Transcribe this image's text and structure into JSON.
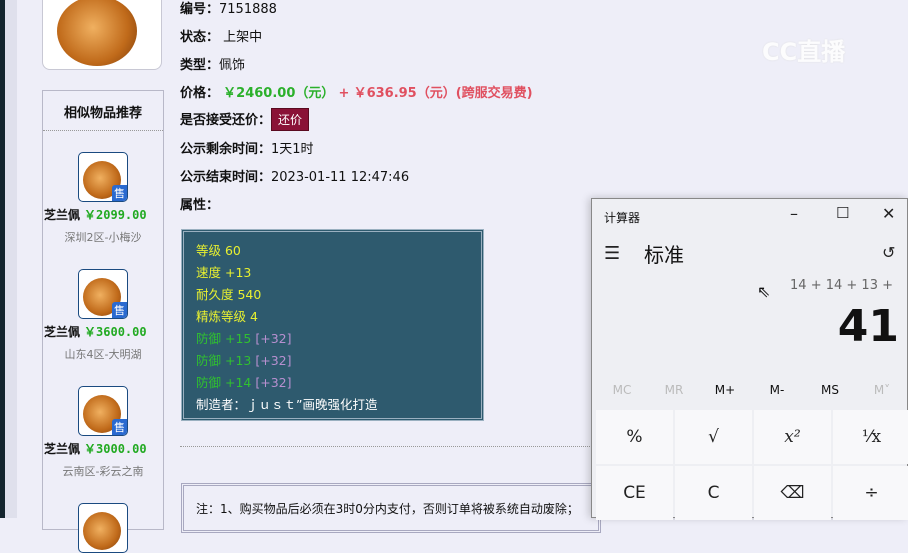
{
  "item": {
    "id_label": "编号：",
    "id": "7151888",
    "status_label": "状态：",
    "status": "上架中",
    "type_label": "类型：",
    "type": "佩饰",
    "price_label": "价格：",
    "price": "￥2460.00（元）",
    "plus": "+",
    "fee": "￥636.95（元）(跨服交易费)",
    "bargain_label": "是否接受还价：",
    "bargain_button": "还价",
    "remain_label": "公示剩余时间：",
    "remain": "1天1时",
    "end_label": "公示结束时间：",
    "end": "2023-01-11 12:47:46",
    "attr_label": "属性："
  },
  "attributes": {
    "level": "等级 60",
    "speed": "速度 +13",
    "durability": "耐久度 540",
    "refine": "精炼等级 4",
    "defense": [
      {
        "v": "防御 +15",
        "b": "[+32]"
      },
      {
        "v": "防御 +13",
        "b": "[+32]"
      },
      {
        "v": "防御 +14",
        "b": "[+32]"
      }
    ],
    "maker": "制造者：ｊｕｓｔ”画晚强化打造"
  },
  "note": "注：1、购买物品后必须在3时0分内支付，否则订单将被系统自动废除；",
  "recommend": {
    "title": "相似物品推荐",
    "sell_badge": "售",
    "items": [
      {
        "name": "芝兰佩",
        "price": "￥2099.00",
        "server": "深圳2区-小梅沙"
      },
      {
        "name": "芝兰佩",
        "price": "￥3600.00",
        "server": "山东4区-大明湖"
      },
      {
        "name": "芝兰佩",
        "price": "￥3000.00",
        "server": "云南区-彩云之南"
      }
    ]
  },
  "watermark": "CC直播",
  "calculator": {
    "title": "计算器",
    "mode": "标准",
    "expression": "14 + 14 + 13 +",
    "result": "41",
    "memory": [
      "MC",
      "MR",
      "M+",
      "M-",
      "MS",
      "M˅"
    ],
    "keys": [
      "%",
      "√",
      "x²",
      "⅟x",
      "CE",
      "C",
      "⌫",
      "÷"
    ]
  }
}
